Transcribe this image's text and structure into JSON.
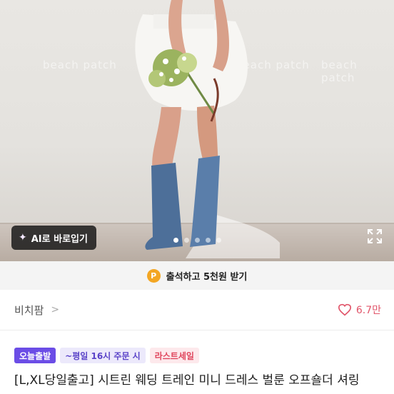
{
  "hero": {
    "watermark": "beach patch",
    "ai_button_label": "AI로 바로입기",
    "slide_count": 5,
    "active_slide": 1
  },
  "attendance": {
    "badge": "P",
    "label": "출석하고 5천원 받기"
  },
  "seller": {
    "name": "비치팜",
    "likes": "6.7만"
  },
  "product": {
    "badges": [
      "오늘출발",
      "~평일 16시 주문 시",
      "라스트세일"
    ],
    "title": "[L,XL당일출고] 시트린 웨딩 트레인 미니 드레스 벌룬 오프숄더 셔링"
  },
  "colors": {
    "accent_purple": "#6b4de6",
    "like_pink": "#e1556a",
    "point_orange": "#f3a623"
  }
}
